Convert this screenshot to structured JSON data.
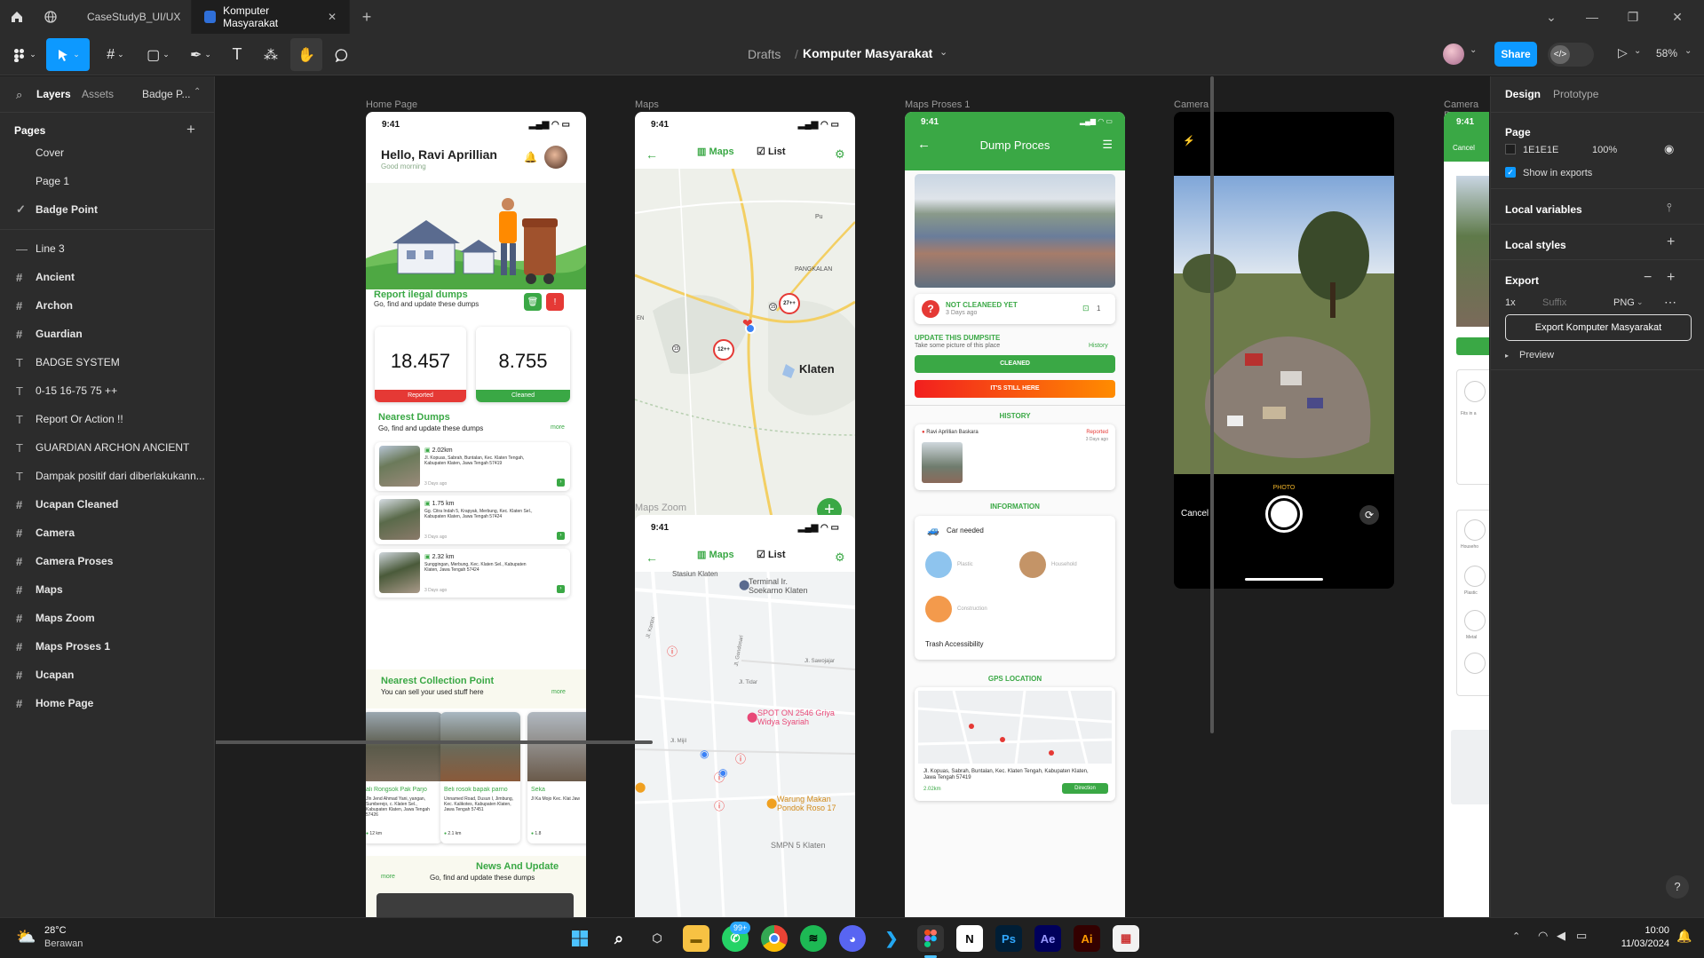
{
  "tabs": [
    {
      "label": "CaseStudyB_UI/UX",
      "color": "#6b3fa0"
    },
    {
      "label": "Komputer Masyarakat",
      "color": "#2f6fd8"
    }
  ],
  "toolbar": {
    "breadcrumb_root": "Drafts",
    "breadcrumb_sep": "/",
    "file_name": "Komputer Masyarakat",
    "share_label": "Share",
    "zoom": "58%"
  },
  "left_panel": {
    "tabs": [
      "Layers",
      "Assets"
    ],
    "page_dropdown": "Badge P...",
    "pages_header": "Pages",
    "pages": [
      "Cover",
      "Page 1",
      "Badge Point"
    ],
    "current_page": "Badge Point",
    "layers": [
      {
        "icon": "line",
        "name": "Line 3"
      },
      {
        "icon": "frame",
        "name": "Ancient"
      },
      {
        "icon": "frame",
        "name": "Archon"
      },
      {
        "icon": "frame",
        "name": "Guardian"
      },
      {
        "icon": "text",
        "name": "BADGE SYSTEM"
      },
      {
        "icon": "text",
        "name": "0-15 16-75 75 ++"
      },
      {
        "icon": "text",
        "name": "Report Or Action !!"
      },
      {
        "icon": "text",
        "name": "GUARDIAN ARCHON ANCIENT"
      },
      {
        "icon": "text",
        "name": "Dampak positif dari diberlakukann..."
      },
      {
        "icon": "frame",
        "name": "Ucapan Cleaned"
      },
      {
        "icon": "frame",
        "name": "Camera"
      },
      {
        "icon": "frame",
        "name": "Camera Proses"
      },
      {
        "icon": "frame",
        "name": "Maps"
      },
      {
        "icon": "frame",
        "name": "Maps Zoom"
      },
      {
        "icon": "frame",
        "name": "Maps Proses 1"
      },
      {
        "icon": "frame",
        "name": "Ucapan"
      },
      {
        "icon": "frame",
        "name": "Home Page"
      }
    ]
  },
  "frames": {
    "home_label": "Home Page",
    "maps_label": "Maps",
    "maps_zoom_label": "Maps Zoom",
    "maps_proses_label": "Maps Proses 1",
    "camera_label": "Camera",
    "camera_proses_label": "Camera Pro"
  },
  "home": {
    "time": "9:41",
    "greeting": "Hello, Ravi Aprillian",
    "subgreeting": "Good morning",
    "report_title": "Report ilegal dumps",
    "report_sub": "Go, find and update these dumps",
    "reported_count": "18.457",
    "reported_label": "Reported",
    "cleaned_count": "8.755",
    "cleaned_label": "Cleaned",
    "nearest_title": "Nearest Dumps",
    "nearest_sub": "Go, find and update these dumps",
    "more": "more",
    "dumps": [
      {
        "dist": "2.02km",
        "addr": "Jl. Kopuas, Sabrah, Buntalan, Kec. Klaten Tengah, Kabupaten Klaten, Jawa Tengah 57419",
        "ago": "3 Days ago"
      },
      {
        "dist": "1.75 km",
        "addr": "Gg. Citra Indah 5, Krapyak, Merbung, Kec. Klaten Sel., Kabupaten Klaten, Jawa Tengah 57424",
        "ago": "3 Days ago"
      },
      {
        "dist": "2.32 km",
        "addr": "Sunggingan, Merbung, Kec. Klaten Sel., Kabupaten Klaten, Jawa Tengah 57424",
        "ago": "3 Days ago"
      }
    ],
    "collection_title": "Nearest Collection Point",
    "collection_sub": "You can sell your used stuff here",
    "collection": [
      {
        "name": "ali Rongsok Pak Parjo",
        "addr": "Jln Jend Ahmad Yani, yangan, Sumberejo, c. Klaten Sel., Kabupaten Klaten, Jawa Tengah 57426",
        "dist": "12 km"
      },
      {
        "name": "Beli rosok bapak parno",
        "addr": "Unnamed Road, Dusun I, Jimbung, Kec. Kalikotes, Kabupaten Klaten, Jawa Tengah 57451",
        "dist": "2.1 km"
      },
      {
        "name": "Seka",
        "addr": "Jl Ka Mojo Kec. Klat Jaw",
        "dist": "1.8"
      }
    ],
    "news_title": "News And Update",
    "news_sub": "Go, find and update these dumps"
  },
  "maps": {
    "time": "9:41",
    "tab_maps": "Maps",
    "tab_list": "List",
    "place_klaten": "Klaten",
    "place_pangkalan": "PANGKALAN",
    "pin1": "27++",
    "pin2": "12++",
    "road1": "15",
    "road2": "15",
    "road3": "15"
  },
  "maps_zoom": {
    "time": "9:41",
    "tab_maps": "Maps",
    "tab_list": "List",
    "poi1": "Terminal Ir. Soekarno Klaten",
    "poi2": "SPOT ON 2546 Griya Widya Syariah",
    "poi3": "Warung Makan Pondok Roso 17",
    "poi4": "SMPN 5 Klaten",
    "poi5": "Stasiun Klaten",
    "road1": "Jl. Kartini",
    "road2": "Jl. Tidar",
    "road3": "Jl. Sawojajar",
    "road4": "Jl. Mijil",
    "road5": "Jl. Gondosari"
  },
  "proses": {
    "time": "9:41",
    "title": "Dump Proces",
    "status": "NOT CLEANEED YET",
    "status_ago": "3 Days ago",
    "photo_count": "1",
    "update_title": "UPDATE THIS DUMPSITE",
    "update_sub": "Take some picture of this place",
    "history_link": "History",
    "btn_cleaned": "CLEANED",
    "btn_still": "IT'S STILL HERE",
    "history_title": "HISTORY",
    "history_user": "Ravi Aprillian Baskara",
    "history_status": "Reported",
    "history_ago": "3 Days ago",
    "info_title": "INFORMATION",
    "car_needed": "Car needed",
    "types": [
      "Plastic",
      "Household",
      "Construction"
    ],
    "trash_access": "Trash Accessibility",
    "gps_title": "GPS LOCATION",
    "gps_addr": "Jl. Kopuas, Sabrah, Buntalan, Kec. Klaten Tengah, Kabupaten Klaten, Jawa Tengah 57419",
    "gps_dist": "2.02km",
    "direction": "Direction"
  },
  "camera": {
    "mode": "PHOTO",
    "cancel": "Cancel"
  },
  "camera_proses": {
    "time": "9:41",
    "cancel": "Cancel",
    "labels": [
      "Fits in a",
      "Househo",
      "Plastic",
      "Metal"
    ]
  },
  "right_panel": {
    "tab_design": "Design",
    "tab_prototype": "Prototype",
    "page_header": "Page",
    "page_color": "1E1E1E",
    "page_opacity": "100%",
    "show_exports": "Show in exports",
    "local_variables": "Local variables",
    "local_styles": "Local styles",
    "export_header": "Export",
    "export_scale": "1x",
    "export_suffix": "Suffix",
    "export_format": "PNG",
    "export_button": "Export Komputer Masyarakat",
    "preview": "Preview",
    "help": "?"
  },
  "taskbar": {
    "temp": "28°C",
    "weather": "Berawan",
    "badge": "99+",
    "time": "10:00",
    "date": "11/03/2024"
  },
  "colors": {
    "accent": "#0d99ff",
    "green": "#3aa845",
    "red": "#e53935",
    "orange": "#ff7a00"
  }
}
